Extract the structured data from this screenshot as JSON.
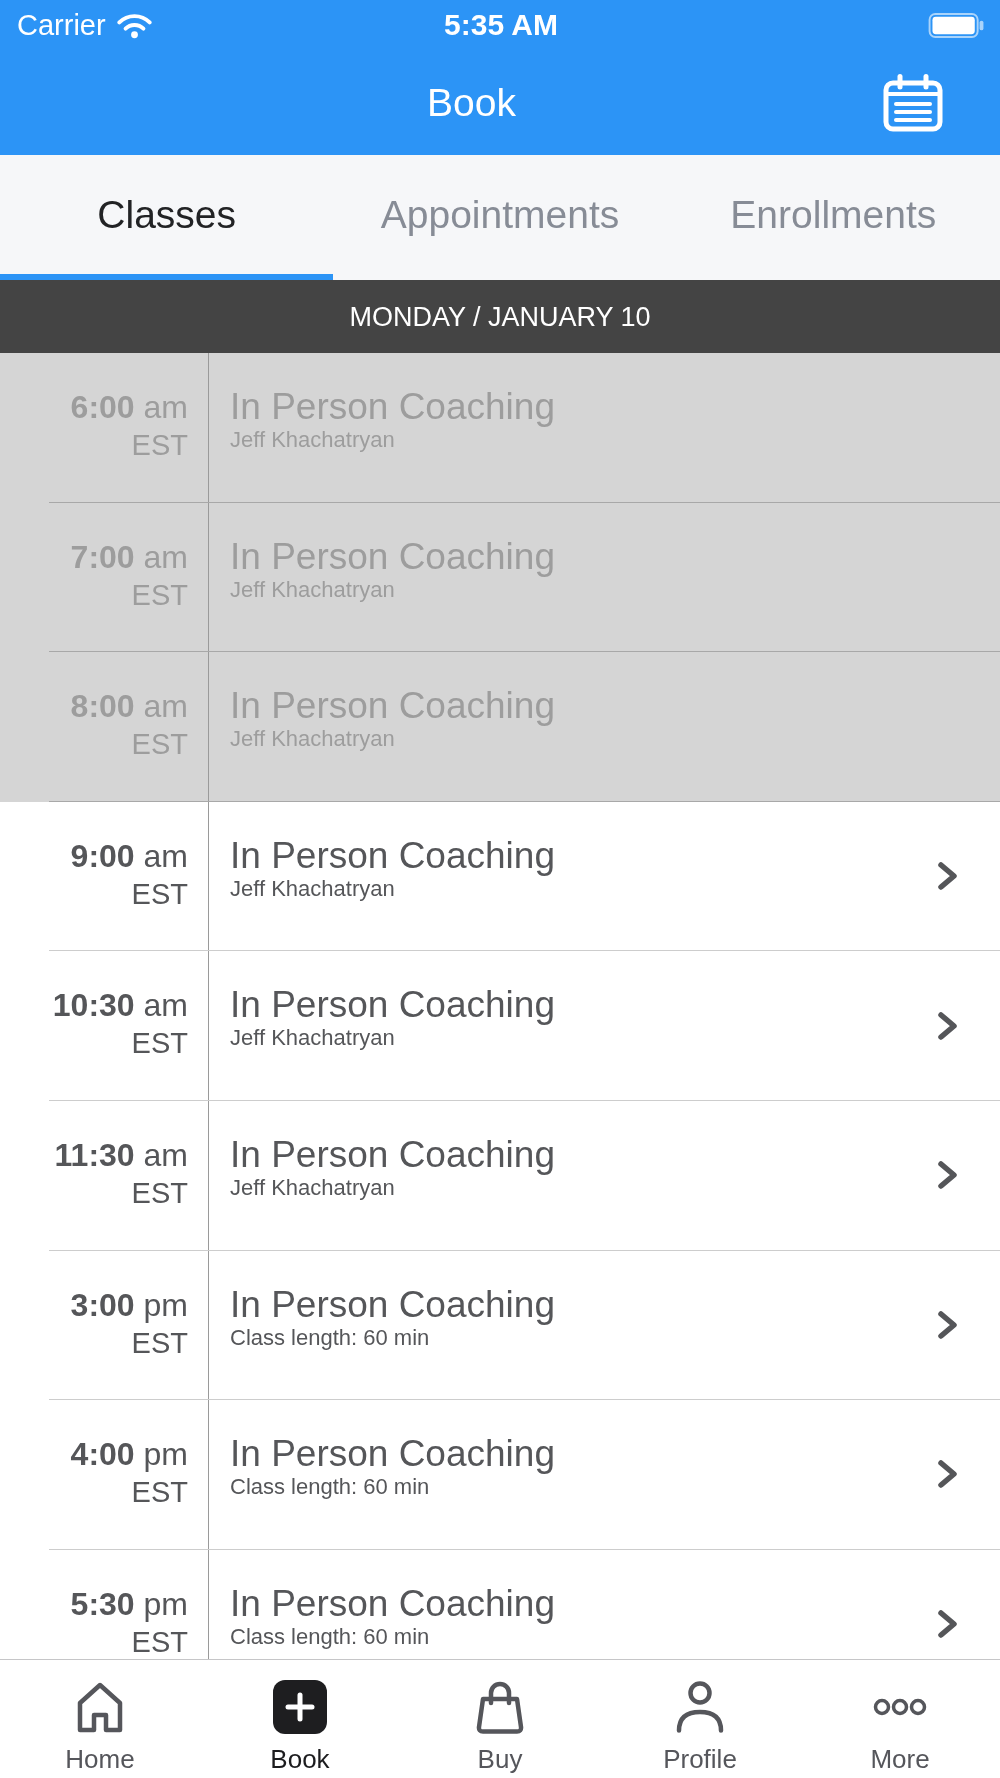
{
  "status_bar": {
    "carrier": "Carrier",
    "time": "5:35 AM"
  },
  "header": {
    "title": "Book"
  },
  "tabs": [
    {
      "label": "Classes",
      "selected": true
    },
    {
      "label": "Appointments",
      "selected": false
    },
    {
      "label": "Enrollments",
      "selected": false
    }
  ],
  "date_header": "MONDAY / JANUARY 10",
  "classes": [
    {
      "time": "**6:00** am",
      "zone": "EST",
      "title": "In Person Coaching",
      "detail": "Jeff Khachatryan",
      "disabled": true
    },
    {
      "time": "**7:00** am",
      "zone": "EST",
      "title": "In Person Coaching",
      "detail": "Jeff Khachatryan",
      "disabled": true
    },
    {
      "time": "**8:00** am",
      "zone": "EST",
      "title": "In Person Coaching",
      "detail": "Jeff Khachatryan",
      "disabled": true
    },
    {
      "time": "**9:00** am",
      "zone": "EST",
      "title": "In Person Coaching",
      "detail": "Jeff Khachatryan",
      "disabled": false
    },
    {
      "time": "**10:30** am",
      "zone": "EST",
      "title": "In Person Coaching",
      "detail": "Jeff Khachatryan",
      "disabled": false
    },
    {
      "time": "**11:30** am",
      "zone": "EST",
      "title": "In Person Coaching",
      "detail": "Jeff Khachatryan",
      "disabled": false
    },
    {
      "time": "**3:00** pm",
      "zone": "EST",
      "title": "In Person Coaching",
      "detail": "Class length: 60 min",
      "disabled": false
    },
    {
      "time": "**4:00** pm",
      "zone": "EST",
      "title": "In Person Coaching",
      "detail": "Class length: 60 min",
      "disabled": false
    },
    {
      "time": "**5:30** pm",
      "zone": "EST",
      "title": "In Person Coaching",
      "detail": "Class length: 60 min",
      "disabled": false
    }
  ],
  "tab_bar": [
    {
      "label": "Home",
      "selected": false
    },
    {
      "label": "Book",
      "selected": true
    },
    {
      "label": "Buy",
      "selected": false
    },
    {
      "label": "Profile",
      "selected": false
    },
    {
      "label": "More",
      "selected": false
    }
  ]
}
